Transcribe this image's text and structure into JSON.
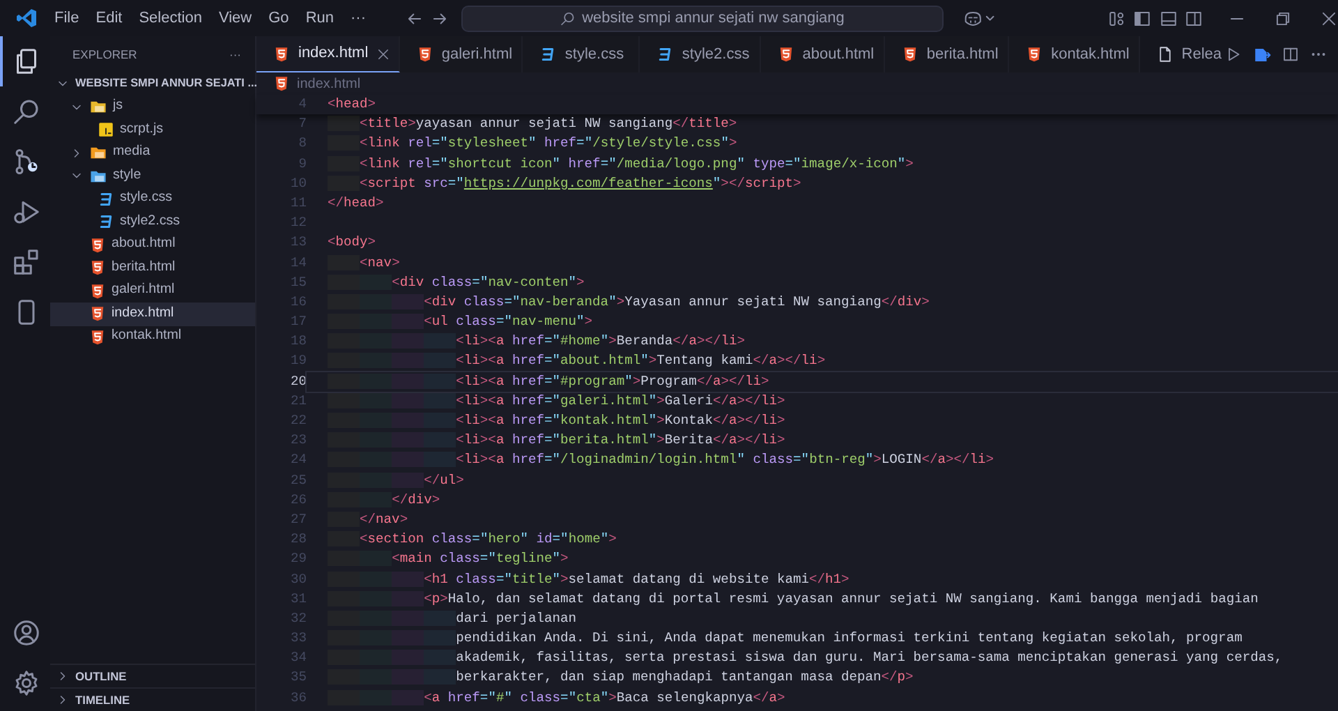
{
  "title_bar": {
    "menu": [
      "File",
      "Edit",
      "Selection",
      "View",
      "Go",
      "Run",
      "···"
    ],
    "command_center": "website smpi annur sejati nw sangiang"
  },
  "activity_bar": [
    {
      "kind": "files",
      "selected": true
    },
    {
      "kind": "search",
      "selected": false
    },
    {
      "kind": "source-control",
      "selected": false
    },
    {
      "kind": "debug",
      "selected": false
    },
    {
      "kind": "extensions",
      "selected": false
    },
    {
      "kind": "device",
      "selected": false
    }
  ],
  "sidebar": {
    "title": "EXPLORER",
    "more": "···",
    "root": {
      "label": "WEBSITE SMPI ANNUR SEJATI ...",
      "expanded": true
    },
    "tree": [
      {
        "label": "js",
        "kind": "folder",
        "color": "#e8b92c",
        "expanded": true,
        "selected": false,
        "children": [
          {
            "label": "scrpt.js",
            "kind": "js",
            "selected": false
          }
        ]
      },
      {
        "label": "media",
        "kind": "folder",
        "color": "#f29b1f",
        "expanded": false,
        "selected": false
      },
      {
        "label": "style",
        "kind": "folder",
        "color": "#4aa3e8",
        "expanded": true,
        "selected": false,
        "children": [
          {
            "label": "style.css",
            "kind": "css",
            "selected": false
          },
          {
            "label": "style2.css",
            "kind": "css",
            "selected": false
          }
        ]
      },
      {
        "label": "about.html",
        "kind": "html",
        "selected": false
      },
      {
        "label": "berita.html",
        "kind": "html",
        "selected": false
      },
      {
        "label": "galeri.html",
        "kind": "html",
        "selected": false
      },
      {
        "label": "index.html",
        "kind": "html",
        "selected": true
      },
      {
        "label": "kontak.html",
        "kind": "html",
        "selected": false
      }
    ],
    "panels": [
      {
        "label": "OUTLINE",
        "expanded": false
      },
      {
        "label": "TIMELINE",
        "expanded": false
      }
    ]
  },
  "tabs": [
    {
      "label": "index.html",
      "kind": "html",
      "selected": true
    },
    {
      "label": "galeri.html",
      "kind": "html",
      "selected": false
    },
    {
      "label": "style.css",
      "kind": "css",
      "selected": false
    },
    {
      "label": "style2.css",
      "kind": "css",
      "selected": false
    },
    {
      "label": "about.html",
      "kind": "html",
      "selected": false
    },
    {
      "label": "berita.html",
      "kind": "html",
      "selected": false
    },
    {
      "label": "kontak.html",
      "kind": "html",
      "selected": false
    },
    {
      "label": "Relea",
      "kind": "file",
      "selected": false
    }
  ],
  "breadcrumb": {
    "label": "index.html",
    "kind": "html"
  },
  "editor": {
    "sticky_scroll": [
      {
        "number": "4",
        "text": "<head>"
      }
    ],
    "lines": [
      {
        "number": "7",
        "text": "    <title>yayasan annur sejati NW sangiang</title>",
        "current": false,
        "underlined": false
      },
      {
        "number": "8",
        "text": "    <link rel=\"stylesheet\" href=\"/style/style.css\">",
        "current": false,
        "underlined": false
      },
      {
        "number": "9",
        "text": "    <link rel=\"shortcut icon\" href=\"/media/logo.png\" type=\"image/x-icon\">",
        "current": false,
        "underlined": false
      },
      {
        "number": "10",
        "text": "    <script src=\"https://unpkg.com/feather-icons\"></script>",
        "current": false,
        "underlined": true
      },
      {
        "number": "11",
        "text": "</head>",
        "current": false,
        "underlined": false
      },
      {
        "number": "12",
        "current": false
      },
      {
        "number": "13",
        "text": "<body>",
        "current": false,
        "underlined": false
      },
      {
        "number": "14",
        "text": "    <nav>",
        "current": false,
        "underlined": false
      },
      {
        "number": "15",
        "text": "        <div class=\"nav-conten\">",
        "current": false,
        "underlined": false
      },
      {
        "number": "16",
        "text": "            <div class=\"nav-beranda\">Yayasan annur sejati NW sangiang</div>",
        "current": false,
        "underlined": false
      },
      {
        "number": "17",
        "text": "            <ul class=\"nav-menu\">",
        "current": false,
        "underlined": false
      },
      {
        "number": "18",
        "text": "                <li><a href=\"#home\">Beranda</a></li>",
        "current": false,
        "underlined": false
      },
      {
        "number": "19",
        "text": "                <li><a href=\"about.html\">Tentang kami</a></li>",
        "current": false,
        "underlined": false
      },
      {
        "number": "20",
        "text": "                <li><a href=\"#program\">Program</a></li>",
        "current": true,
        "underlined": false
      },
      {
        "number": "21",
        "text": "                <li><a href=\"galeri.html\">Galeri</a></li>",
        "current": false,
        "underlined": false
      },
      {
        "number": "22",
        "text": "                <li><a href=\"kontak.html\">Kontak</a></li>",
        "current": false,
        "underlined": false
      },
      {
        "number": "23",
        "text": "                <li><a href=\"berita.html\">Berita</a></li>",
        "current": false,
        "underlined": false
      },
      {
        "number": "24",
        "text": "                <li><a href=\"/loginadmin/login.html\" class=\"btn-reg\">LOGIN</a></li>",
        "current": false,
        "underlined": false
      },
      {
        "number": "25",
        "text": "            </ul>",
        "current": false,
        "underlined": false
      },
      {
        "number": "26",
        "text": "        </div>",
        "current": false,
        "underlined": false
      },
      {
        "number": "27",
        "text": "    </nav>",
        "current": false,
        "underlined": false
      },
      {
        "number": "28",
        "text": "    <section class=\"hero\" id=\"home\">",
        "current": false,
        "underlined": false
      },
      {
        "number": "29",
        "text": "        <main class=\"tegline\">",
        "current": false,
        "underlined": false
      },
      {
        "number": "30",
        "text": "            <h1 class=\"title\">selamat datang di website kami</h1>",
        "current": false,
        "underlined": false
      },
      {
        "number": "31",
        "text": "            <p>Halo, dan selamat datang di portal resmi yayasan annur sejati NW sangiang. Kami bangga menjadi bagian",
        "current": false,
        "underlined": false
      },
      {
        "number": "32",
        "text": "                dari perjalanan",
        "current": false,
        "underlined": false
      },
      {
        "number": "33",
        "text": "                pendidikan Anda. Di sini, Anda dapat menemukan informasi terkini tentang kegiatan sekolah, program",
        "current": false,
        "underlined": false
      },
      {
        "number": "34",
        "text": "                akademik, fasilitas, serta prestasi siswa dan guru. Mari bersama-sama menciptakan generasi yang cerdas,",
        "current": false,
        "underlined": false
      },
      {
        "number": "35",
        "text": "                berkarakter, dan siap menghadapi tantangan masa depan</p>",
        "current": false,
        "underlined": false
      },
      {
        "number": "36",
        "text": "            <a href=\"#\" class=\"cta\">Baca selengkapnya</a>",
        "current": false,
        "underlined": false
      }
    ]
  }
}
